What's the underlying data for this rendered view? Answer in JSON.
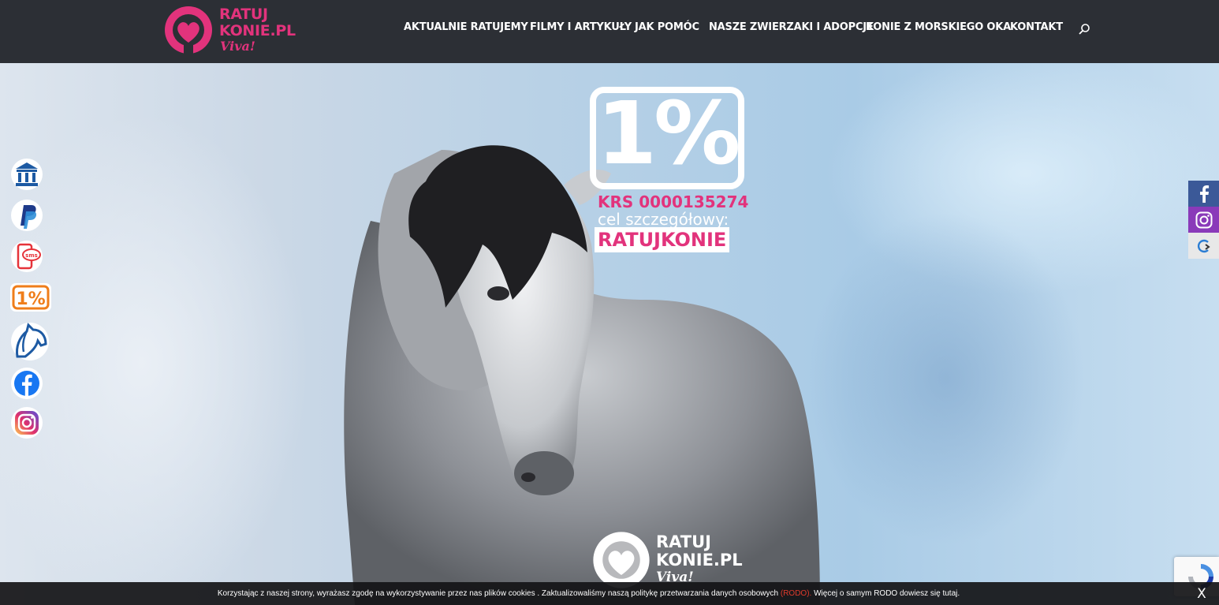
{
  "brand": {
    "logo_line1": "RATUJ",
    "logo_line2": "KONIE.PL",
    "logo_script": "Viva!",
    "color_primary": "#e2337c",
    "color_header": "#2c2f35"
  },
  "nav": {
    "items": [
      {
        "label": "AKTUALNIE RATUJEMY"
      },
      {
        "label": "FILMY I ARTYKUŁY"
      },
      {
        "label": "JAK POMÓC"
      },
      {
        "label": "NASZE ZWIERZAKI I ADOPCJE"
      },
      {
        "label": "KONIE Z MORSKIEGO OKA"
      },
      {
        "label": "KONTAKT"
      }
    ],
    "search_icon": "search-icon"
  },
  "hero": {
    "badge_pct": "1%",
    "krs": "KRS 0000135274",
    "cel": "cel szczegółowy:",
    "tag": "RATUJKONIE",
    "bottom_logo_line1": "RATUJ",
    "bottom_logo_line2": "KONIE.PL",
    "bottom_logo_script": "Viva!"
  },
  "left_icons": [
    {
      "icon": "bank-icon"
    },
    {
      "icon": "paypal-icon"
    },
    {
      "icon": "sms-icon"
    },
    {
      "icon": "one-percent-icon"
    },
    {
      "icon": "horse-head-icon"
    },
    {
      "icon": "facebook-icon"
    },
    {
      "icon": "instagram-icon"
    }
  ],
  "right_bar": [
    {
      "icon": "facebook-icon",
      "color": "#3b5998"
    },
    {
      "icon": "instagram-icon",
      "color": "#8a3ab9"
    },
    {
      "icon": "share-icon",
      "color": "#e8e8e8"
    }
  ],
  "cookie": {
    "text_before": "Korzystając z naszej strony, wyrażasz zgodę na wykorzystywanie przez nas plików cookies . Zaktualizowaliśmy naszą politykę przetwarzania danych osobowych ",
    "rodo": "(RODO).",
    "text_after": " Więcej o samym RODO dowiesz się tutaj.",
    "close": "X"
  }
}
